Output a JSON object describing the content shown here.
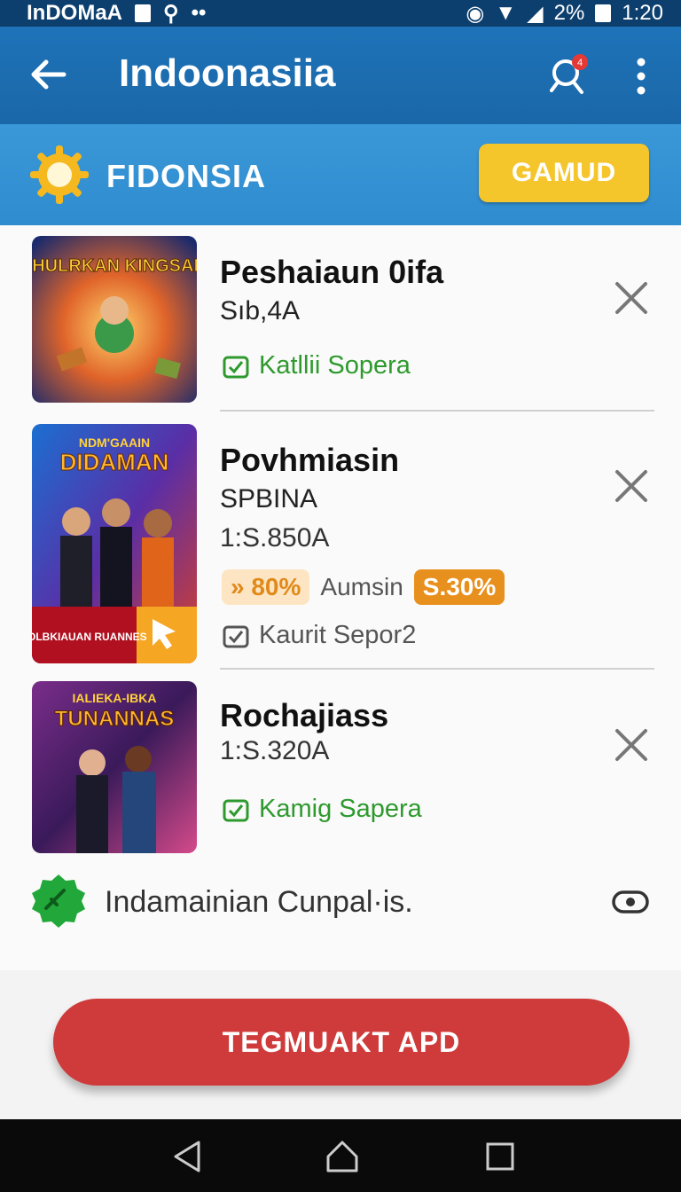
{
  "status": {
    "carrier": "InDOMaA",
    "battery": "2%",
    "time": "1:20"
  },
  "appbar": {
    "title": "Indoonasiia",
    "notification_count": "4"
  },
  "banner": {
    "name": "FIDONSIA",
    "button": "GAMUD"
  },
  "items": [
    {
      "title": "Peshaiaun 0ifa",
      "subtitle": "Sıb,4A",
      "tag": "Katllii Sopera",
      "tag_color": "#2e9a2e",
      "thumb_title": "SHULRKAN KINGSAM"
    },
    {
      "title": "Povhmiasin",
      "subtitle": "SPBINA",
      "price": "1:S.850A",
      "discount_left": "80%",
      "discount_mid": "Aumsin",
      "discount_right": "S.30%",
      "tag": "Kaurit Sepor2",
      "tag_color": "#555555",
      "thumb_title": "DIDAMAN",
      "thumb_top": "NDM'GAAIN",
      "thumb_banner": "DOLBKIAUAN RUANNES"
    },
    {
      "title": "Rochajiass",
      "price": "1:S.320A",
      "tag": "Kamig Sapera",
      "tag_color": "#2e9a2e",
      "thumb_title": "TUNANNAS",
      "thumb_top": "IALIEKA-IBKA"
    }
  ],
  "footer_row": {
    "text": "Indamainian Cunpal·is."
  },
  "cta": {
    "label": "TEGMUAKT APD"
  },
  "colors": {
    "appbar": "#1e73b8",
    "banner": "#3a98d8",
    "button": "#f5c52c",
    "cta": "#cf3a3a"
  }
}
